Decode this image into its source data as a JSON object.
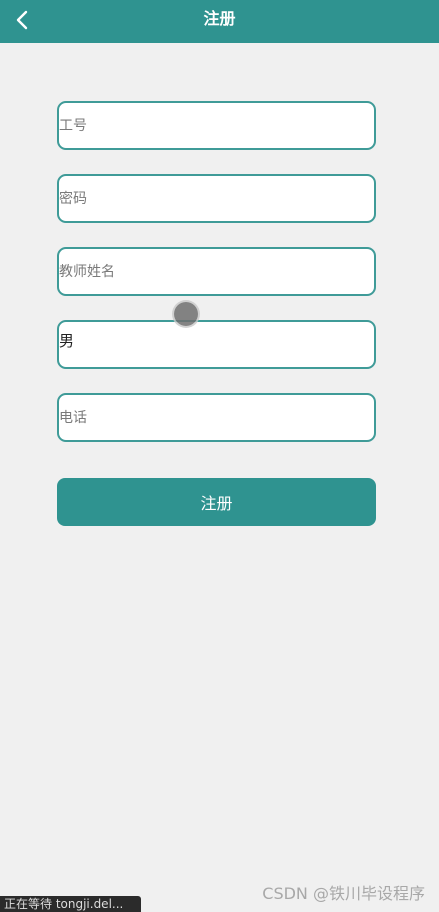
{
  "header": {
    "title": "注册",
    "back_icon": "chevron-left-icon"
  },
  "form": {
    "employee_id": {
      "placeholder": "工号",
      "value": ""
    },
    "password": {
      "placeholder": "密码",
      "value": ""
    },
    "teacher_name": {
      "placeholder": "教师姓名",
      "value": ""
    },
    "gender": {
      "value": "男"
    },
    "phone": {
      "placeholder": "电话",
      "value": ""
    }
  },
  "submit_label": "注册",
  "status_text": "正在等待 tongji.del...",
  "watermark": "CSDN @铁川毕设程序",
  "colors": {
    "accent": "#2f9390",
    "field_border": "#3f9b98",
    "background": "#f0f0f0"
  }
}
